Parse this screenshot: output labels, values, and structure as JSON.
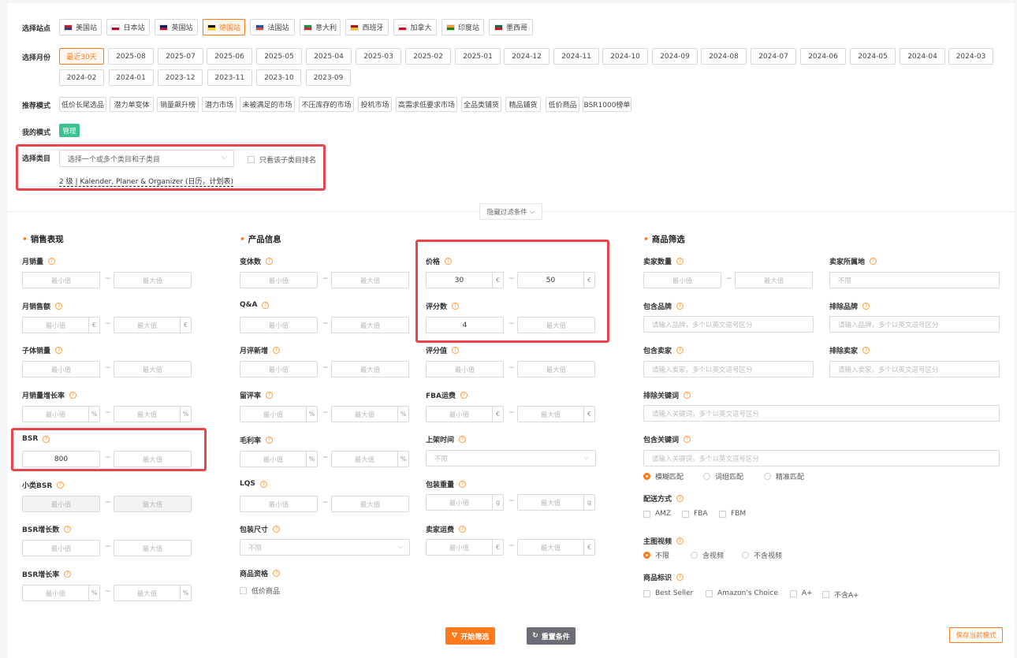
{
  "filters": {
    "site_label": "选择站点",
    "sites": [
      {
        "label": "美国站",
        "icon": "us-flag-icon",
        "c1": "#b22234",
        "c2": "#3c3b6e"
      },
      {
        "label": "日本站",
        "icon": "jp-flag-icon",
        "c1": "#ffffff",
        "c2": "#bc002d"
      },
      {
        "label": "英国站",
        "icon": "uk-flag-icon",
        "c1": "#012169",
        "c2": "#c8102e"
      },
      {
        "label": "德国站",
        "icon": "de-flag-icon",
        "c1": "#000000",
        "c2": "#ffce00"
      },
      {
        "label": "法国站",
        "icon": "fr-flag-icon",
        "c1": "#0055a4",
        "c2": "#ef4135"
      },
      {
        "label": "意大利",
        "icon": "it-flag-icon",
        "c1": "#009246",
        "c2": "#ce2b37"
      },
      {
        "label": "西班牙",
        "icon": "es-flag-icon",
        "c1": "#aa151b",
        "c2": "#f1bf00"
      },
      {
        "label": "加拿大",
        "icon": "ca-flag-icon",
        "c1": "#ffffff",
        "c2": "#d80621"
      },
      {
        "label": "印度站",
        "icon": "in-flag-icon",
        "c1": "#ff9933",
        "c2": "#138808"
      },
      {
        "label": "墨西哥",
        "icon": "mx-flag-icon",
        "c1": "#006847",
        "c2": "#ce1126"
      }
    ],
    "month_label": "选择月份",
    "months": [
      "最近30天",
      "2025-08",
      "2025-07",
      "2025-06",
      "2025-05",
      "2025-04",
      "2025-03",
      "2025-02",
      "2025-01",
      "2024-12",
      "2024-11",
      "2024-10",
      "2024-09",
      "2024-08",
      "2024-07",
      "2024-06",
      "2024-05",
      "2024-04",
      "2024-03",
      "2024-02",
      "2024-01",
      "2023-12",
      "2023-11",
      "2023-10",
      "2023-09"
    ],
    "mode_label": "推荐模式",
    "modes": [
      "低价长尾选品",
      "潜力单变体",
      "销量飙升榜",
      "潜力市场",
      "未被满足的市场",
      "不压库存的市场",
      "投机市场",
      "高需求低要求市场",
      "全品类铺货",
      "精品铺货",
      "低价商品",
      "BSR1000榜单"
    ],
    "my_mode_label": "我的模式",
    "manage": "管理",
    "category_label": "选择类目",
    "category_placeholder": "选择一个或多个类目和子类目",
    "subcat_only": "只看该子类目排名",
    "selected_category": "2 级 | Kalender, Planer & Organizer (日历，计划表)",
    "hide_filters": "隐藏过滤条件"
  },
  "placeholders": {
    "min": "最小值",
    "max": "最大值",
    "none": "不限"
  },
  "sections": {
    "sales": "销售表现",
    "product": "产品信息",
    "goods": "商品筛选"
  },
  "units": {
    "eur": "€",
    "pct": "%",
    "g": "g"
  },
  "sales": {
    "monthly_sales": "月销量",
    "monthly_revenue": "月销售额",
    "child_sales": "子体销量",
    "sales_growth": "月销量增长率",
    "bsr": "BSR",
    "bsr_value": "800",
    "sub_bsr": "小类BSR",
    "bsr_growth_count": "BSR增长数",
    "bsr_growth_rate": "BSR增长率"
  },
  "product": {
    "variants": "变体数",
    "qa": "Q&A",
    "monthly_reviews": "月评新增",
    "bad_review_rate": "留评率",
    "gross_margin": "毛利率",
    "lqs": "LQS",
    "package_size": "包装尺寸",
    "qualification": "商品资格",
    "low_price": "低价商品",
    "price": "价格",
    "price_min": "30",
    "price_max": "50",
    "reviews": "评分数",
    "reviews_min": "4",
    "rating": "评分值",
    "fba_fee": "FBA运费",
    "listing_time": "上架时间",
    "package_weight": "包装重量",
    "seller_shipping": "卖家运费"
  },
  "goods": {
    "seller_count": "卖家数量",
    "seller_location": "卖家所属地",
    "include_brand": "包含品牌",
    "exclude_brand": "排除品牌",
    "brand_ph": "请输入品牌，多个以英文逗号区分",
    "include_seller": "包含卖家",
    "exclude_seller": "排除卖家",
    "seller_ph": "请输入卖家，多个以英文逗号区分",
    "exclude_keyword": "排除关键词",
    "include_keyword": "包含关键词",
    "keyword_ph": "请输入关键词，多个以英文逗号区分",
    "match": [
      "模糊匹配",
      "词组匹配",
      "精准匹配"
    ],
    "delivery": "配送方式",
    "delivery_opts": [
      "AMZ",
      "FBA",
      "FBM"
    ],
    "main_video": "主图视频",
    "video_opts": [
      "不限",
      "含视频",
      "不含视频"
    ],
    "badge": "商品标识",
    "badge_opts": [
      "Best Seller",
      "Amazon's Choice",
      "A+",
      "不含A+"
    ]
  },
  "actions": {
    "start": "开始筛选",
    "reset": "重置条件",
    "save": "保存当前模式"
  },
  "colors": {
    "accent": "#ff7a1a",
    "highlight": "#e8464b",
    "manage": "#3cc18f",
    "reset": "#6b6e74"
  }
}
